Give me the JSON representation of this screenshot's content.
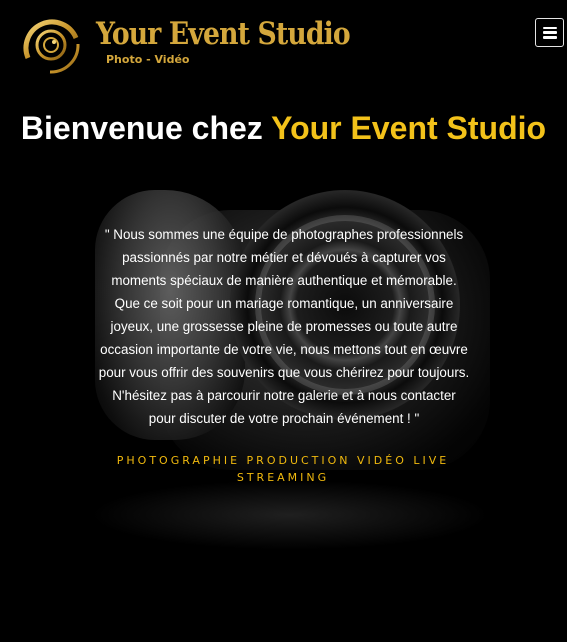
{
  "header": {
    "logo_title": "Your Event Studio",
    "logo_subtitle": "Photo - Vidéo",
    "menu_icon": "hamburger-menu-icon"
  },
  "hero": {
    "title_prefix": "Bienvenue chez ",
    "title_accent": "Your Event Studio",
    "quote": "\" Nous sommes une équipe de photographes professionnels passionnés par notre métier et dévoués à capturer vos moments spéciaux de manière authentique et mémorable. Que ce soit pour un mariage romantique, un anniversaire joyeux, une grossesse pleine de promesses ou toute autre occasion importante de votre vie, nous mettons tout en œuvre pour vous offrir des souvenirs que vous chérirez pour toujours. N'hésitez pas à parcourir notre galerie et à nous contacter pour discuter de votre prochain événement ! \"",
    "services": "PHOTOGRAPHIE PRODUCTION VIDÉO LIVE STREAMING"
  },
  "colors": {
    "background": "#000000",
    "accent": "#f3c21a",
    "logo_gold": "#d4a73c"
  }
}
